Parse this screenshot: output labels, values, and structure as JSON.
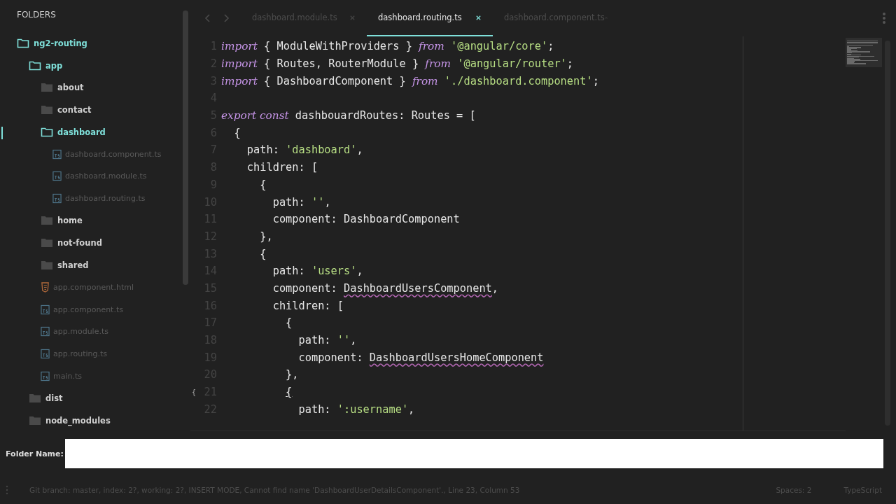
{
  "sidebar": {
    "title": "FOLDERS",
    "tree": [
      {
        "kind": "folder",
        "label": "ng2-routing",
        "expanded": true,
        "selected": false,
        "children": [
          {
            "kind": "folder",
            "label": "app",
            "expanded": true,
            "selected": false,
            "children": [
              {
                "kind": "folder",
                "label": "about",
                "expanded": false,
                "selected": false
              },
              {
                "kind": "folder",
                "label": "contact",
                "expanded": false,
                "selected": false
              },
              {
                "kind": "folder",
                "label": "dashboard",
                "expanded": true,
                "selected": true,
                "children": [
                  {
                    "kind": "ts_file",
                    "label": "dashboard.component.ts",
                    "selected": false
                  },
                  {
                    "kind": "ts_file",
                    "label": "dashboard.module.ts",
                    "selected": false
                  },
                  {
                    "kind": "ts_file",
                    "label": "dashboard.routing.ts",
                    "selected": false
                  }
                ]
              },
              {
                "kind": "folder",
                "label": "home",
                "expanded": false,
                "selected": false
              },
              {
                "kind": "folder",
                "label": "not-found",
                "expanded": false,
                "selected": false
              },
              {
                "kind": "folder",
                "label": "shared",
                "expanded": false,
                "selected": false
              },
              {
                "kind": "html_file",
                "label": "app.component.html",
                "selected": false
              },
              {
                "kind": "ts_file",
                "label": "app.component.ts",
                "selected": false
              },
              {
                "kind": "ts_file",
                "label": "app.module.ts",
                "selected": false
              },
              {
                "kind": "ts_file",
                "label": "app.routing.ts",
                "selected": false
              },
              {
                "kind": "ts_file",
                "label": "main.ts",
                "selected": false
              }
            ]
          },
          {
            "kind": "folder",
            "label": "dist",
            "expanded": false,
            "selected": false
          },
          {
            "kind": "folder",
            "label": "node_modules",
            "expanded": false,
            "selected": false
          }
        ]
      }
    ]
  },
  "tabs": [
    {
      "label": "dashboard.module.ts",
      "selected": false
    },
    {
      "label": "dashboard.routing.ts",
      "selected": true
    },
    {
      "label": "dashboard.component.ts",
      "selected": false
    }
  ],
  "editor": {
    "lines": [
      {
        "number": "1",
        "tokens": [
          {
            "kind": "keyword",
            "text": "import"
          },
          {
            "kind": "plain",
            "text": " { ModuleWithProviders } "
          },
          {
            "kind": "keyword",
            "text": "from"
          },
          {
            "kind": "string",
            "text": " '@angular/core'"
          },
          {
            "kind": "plain",
            "text": ";"
          }
        ]
      },
      {
        "number": "2",
        "tokens": [
          {
            "kind": "keyword",
            "text": "import"
          },
          {
            "kind": "plain",
            "text": " { Routes, RouterModule } "
          },
          {
            "kind": "keyword",
            "text": "from"
          },
          {
            "kind": "string",
            "text": " '@angular/router'"
          },
          {
            "kind": "plain",
            "text": ";"
          }
        ]
      },
      {
        "number": "3",
        "tokens": [
          {
            "kind": "keyword",
            "text": "import"
          },
          {
            "kind": "plain",
            "text": " { DashboardComponent } "
          },
          {
            "kind": "keyword",
            "text": "from"
          },
          {
            "kind": "string",
            "text": " './dashboard.component'"
          },
          {
            "kind": "plain",
            "text": ";"
          }
        ]
      },
      {
        "number": "4"
      },
      {
        "number": "5",
        "tokens": [
          {
            "kind": "keyword",
            "text": "export const"
          },
          {
            "kind": "plain",
            "text": " dashbouardRoutes: Routes = ["
          }
        ]
      },
      {
        "number": "6",
        "tokens": [
          {
            "kind": "plain",
            "text": "  {"
          }
        ]
      },
      {
        "number": "7",
        "tokens": [
          {
            "kind": "plain",
            "text": "    path: "
          },
          {
            "kind": "string",
            "text": "'dashboard'"
          },
          {
            "kind": "plain",
            "text": ","
          }
        ]
      },
      {
        "number": "8",
        "tokens": [
          {
            "kind": "plain",
            "text": "    children: ["
          }
        ]
      },
      {
        "number": "9",
        "tokens": [
          {
            "kind": "plain",
            "text": "      {"
          }
        ]
      },
      {
        "number": "10",
        "tokens": [
          {
            "kind": "plain",
            "text": "        path: "
          },
          {
            "kind": "string",
            "text": "''"
          },
          {
            "kind": "plain",
            "text": ","
          }
        ]
      },
      {
        "number": "11",
        "tokens": [
          {
            "kind": "plain",
            "text": "        component: DashboardComponent"
          }
        ]
      },
      {
        "number": "12",
        "tokens": [
          {
            "kind": "plain",
            "text": "      },"
          }
        ]
      },
      {
        "number": "13",
        "tokens": [
          {
            "kind": "plain",
            "text": "      {"
          }
        ]
      },
      {
        "number": "14",
        "tokens": [
          {
            "kind": "plain",
            "text": "        path: "
          },
          {
            "kind": "string",
            "text": "'users'"
          },
          {
            "kind": "plain",
            "text": ","
          }
        ]
      },
      {
        "number": "15",
        "tokens": [
          {
            "kind": "plain",
            "text": "        component: "
          },
          {
            "kind": "error",
            "text": "DashboardUsersComponent"
          },
          {
            "kind": "plain",
            "text": ","
          }
        ]
      },
      {
        "number": "16",
        "tokens": [
          {
            "kind": "plain",
            "text": "        children: ["
          }
        ]
      },
      {
        "number": "17",
        "tokens": [
          {
            "kind": "plain",
            "text": "          {"
          }
        ]
      },
      {
        "number": "18",
        "tokens": [
          {
            "kind": "plain",
            "text": "            path: "
          },
          {
            "kind": "string",
            "text": "''"
          },
          {
            "kind": "plain",
            "text": ","
          }
        ]
      },
      {
        "number": "19",
        "tokens": [
          {
            "kind": "plain",
            "text": "            component: "
          },
          {
            "kind": "error",
            "text": "DashboardUsersHomeComponent"
          }
        ]
      },
      {
        "number": "20",
        "tokens": [
          {
            "kind": "plain",
            "text": "          },"
          }
        ]
      },
      {
        "number": "21",
        "fold_marker": "{",
        "tokens": [
          {
            "kind": "match",
            "text": "          {"
          }
        ]
      },
      {
        "number": "22",
        "tokens": [
          {
            "kind": "plain",
            "text": "            path: "
          },
          {
            "kind": "string",
            "text": "':username'"
          },
          {
            "kind": "plain",
            "text": ","
          }
        ]
      }
    ]
  },
  "input_panel": {
    "label": "Folder Name:"
  },
  "status_bar": {
    "message": "Git branch: master, index: 2?, working: 2?, INSERT MODE, Cannot find name 'DashboardUserDetailsComponent'., Line 23, Column 53",
    "indentation": "Spaces: 2",
    "language": "TypeScript"
  }
}
